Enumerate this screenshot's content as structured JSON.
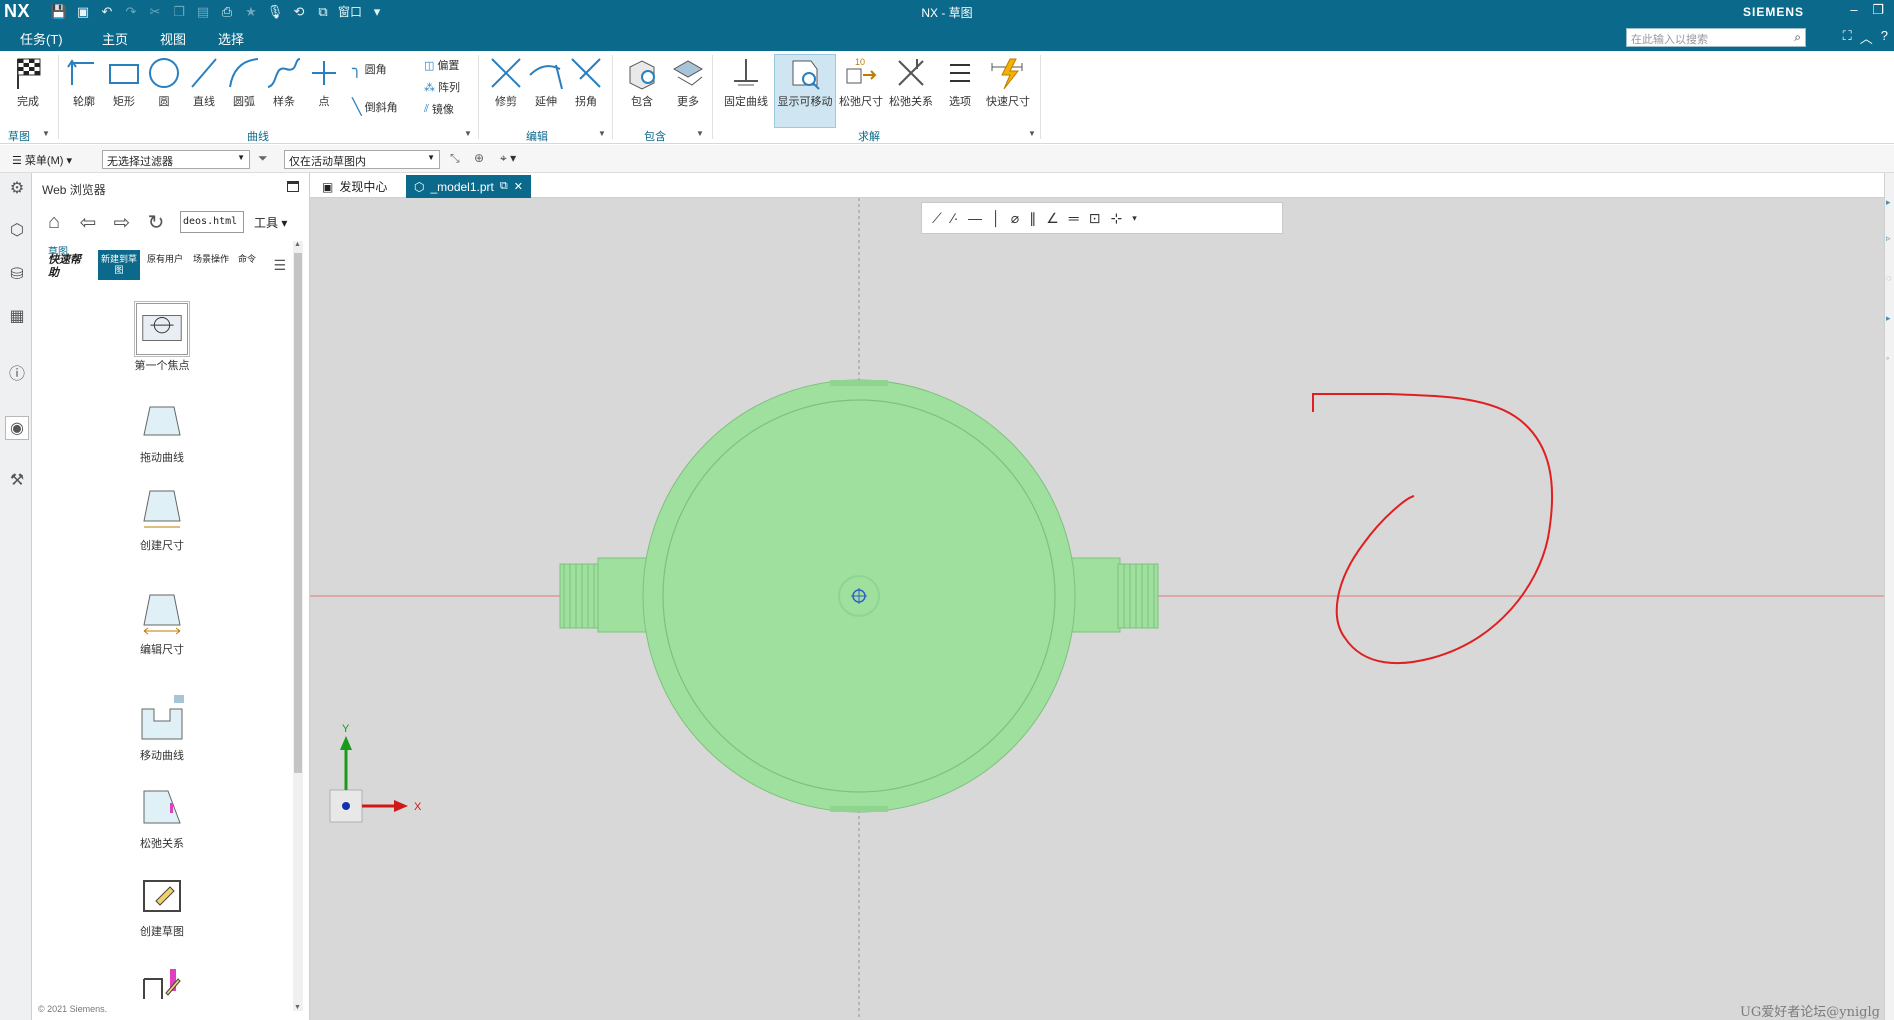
{
  "titlebar": {
    "logo": "NX",
    "title": "NX - 草图",
    "brand": "SIEMENS",
    "window_menu": "窗口",
    "quick_access_icons": [
      "save-icon",
      "save-all-icon",
      "undo-icon",
      "redo-icon",
      "cut-icon",
      "copy-icon",
      "paste-icon",
      "print-icon",
      "star-icon",
      "mic-icon",
      "repeat-icon",
      "window-icon"
    ]
  },
  "menubar": {
    "tabs": [
      {
        "label": "任务(T)",
        "active": false
      },
      {
        "label": "主页",
        "active": true
      },
      {
        "label": "视图",
        "active": false
      },
      {
        "label": "选择",
        "active": false
      }
    ],
    "search_placeholder": "在此输入以搜索"
  },
  "ribbon": {
    "finish": "完成",
    "curve_tools": [
      "轮廓",
      "矩形",
      "圆",
      "直线",
      "圆弧",
      "样条",
      "点"
    ],
    "fillet": "圆角",
    "chamfer": "倒斜角",
    "offset": "偏置",
    "pattern": "阵列",
    "mirror": "镜像",
    "edit_tools": [
      "修剪",
      "延伸",
      "拐角"
    ],
    "include": "包含",
    "more": "更多",
    "fixed_curve": "固定曲线",
    "show_movable": "显示可移动",
    "relax_dim": "松弛尺寸",
    "relax_rel": "松弛关系",
    "options": "选项",
    "rapid_dim": "快速尺寸",
    "dim_badge": "10",
    "groups": {
      "sketch": "草图",
      "curve": "曲线",
      "edit": "编辑",
      "include": "包含",
      "solve": "求解"
    }
  },
  "selbar": {
    "menu": "菜单(M)",
    "filter": "无选择过滤器",
    "scope": "仅在活动草图内"
  },
  "webpanel": {
    "title": "Web 浏览器",
    "url": "deos.html",
    "tools": "工具",
    "help_top": "草图",
    "help_title": "快速帮助",
    "chips": [
      {
        "label": "新建到草图",
        "active": true
      },
      {
        "label": "原有用户",
        "active": false
      },
      {
        "label": "场景操作",
        "active": false
      },
      {
        "label": "命令",
        "active": false
      }
    ],
    "items": [
      "第一个焦点",
      "拖动曲线",
      "创建尺寸",
      "编辑尺寸",
      "移动曲线",
      "松弛关系",
      "创建草图"
    ],
    "copyright": "© 2021 Siemens."
  },
  "graphics": {
    "tabs": [
      {
        "label": "发现中心",
        "active": false
      },
      {
        "label": "_model1.prt",
        "active": true
      }
    ],
    "axis_x": "X",
    "axis_y": "Y",
    "watermark": "UG爱好者论坛@yniglg",
    "model_color": "#9fe09f",
    "sketch_curve_color": "#e02020"
  }
}
